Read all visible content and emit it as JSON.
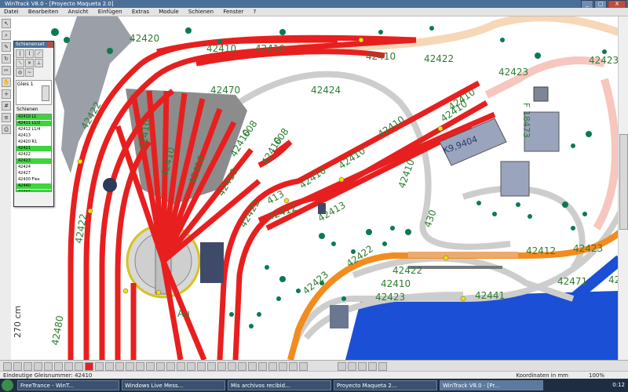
{
  "window": {
    "title": "WinTrack V8.0 - [Proyecto Maqueta 2.0]"
  },
  "window_buttons": [
    "_",
    "▢",
    "X"
  ],
  "menu": [
    "Datei",
    "Bearbeiten",
    "Ansicht",
    "Einfügen",
    "Extras",
    "Module",
    "Schienen",
    "Fenster",
    "?"
  ],
  "ruler": {
    "label": "270 cm"
  },
  "palette": {
    "title": "Schienenset",
    "preview_label": "Gleis 1",
    "preview_sub": "Schienen",
    "items": [
      {
        "text": "42410 L1",
        "sel": true
      },
      {
        "text": "42411 L1/2",
        "sel": true
      },
      {
        "text": "42412 L1/4",
        "sel": false
      },
      {
        "text": "42413",
        "sel": false
      },
      {
        "text": "42420 R1",
        "sel": false
      },
      {
        "text": "42421",
        "sel": true
      },
      {
        "text": "42422",
        "sel": false
      },
      {
        "text": "42423",
        "sel": true
      },
      {
        "text": "42424",
        "sel": false
      },
      {
        "text": "42427",
        "sel": false
      },
      {
        "text": "42430 Flex",
        "sel": false
      },
      {
        "text": "42440",
        "sel": true
      },
      {
        "text": "42441",
        "sel": true
      },
      {
        "text": "42442",
        "sel": true
      }
    ]
  },
  "labels": {
    "t42410": "42410",
    "t42411": "42411",
    "t42412": "42412",
    "t42413": "42413",
    "t42420": "42420",
    "t42422": "42422",
    "t42423": "42423",
    "t42424": "42424",
    "t42470": "42470",
    "t42471": "42471",
    "t42441": "42441",
    "t42480": "42480",
    "t608": "608",
    "t413": "413",
    "t430": "430",
    "building": "K9,9404",
    "f1": "F 18473",
    "aux": "Au"
  },
  "status": {
    "left": "Eindeutige Gleisnummer: 42410",
    "right": "Koordinaten in mm",
    "zoom": "100%"
  },
  "taskbar": {
    "tasks": [
      "FreeTrance - WinT...",
      "Windows Live Mess...",
      "Mis archivos recibid...",
      "Proyecto Maqueta 2...",
      "WinTrack V8.0 - [Pr..."
    ],
    "active_index": 4,
    "clock": "0:12"
  },
  "colors": {
    "track": "#e81f1f",
    "orange": "#f28c1e",
    "grey": "#cdcdcd",
    "pink": "#f6c6bf",
    "green_text": "#2e7d32",
    "water": "#1a4fd6"
  },
  "icons": {
    "tool": [
      "arrow-icon",
      "magnify-icon",
      "pencil-icon",
      "rotate-icon",
      "cut-icon",
      "hand-icon",
      "zoom-icon",
      "grid-icon",
      "layer-icon",
      "print-icon"
    ],
    "bottom": [
      "layer-1-icon",
      "layer-2-icon",
      "layer-3-icon",
      "layer-4-icon",
      "color-icon"
    ]
  }
}
